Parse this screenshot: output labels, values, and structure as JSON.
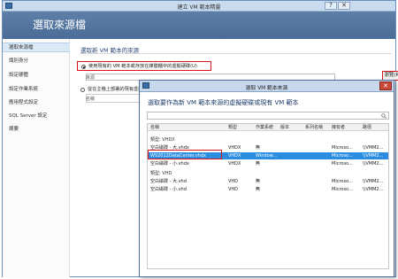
{
  "window": {
    "title": "建立 VM 範本精靈",
    "help_glyph": "?",
    "close_glyph": "✕",
    "page_title": "選取來源檔"
  },
  "sidebar": {
    "items": [
      {
        "label": "選取來源檔",
        "active": true
      },
      {
        "label": "識別身分"
      },
      {
        "label": "設定硬體"
      },
      {
        "label": "設定作業系統"
      },
      {
        "label": "應用程式設定"
      },
      {
        "label": "SQL Server 設定"
      },
      {
        "label": "摘要"
      }
    ]
  },
  "main": {
    "section_heading": "選取新 VM 範本的來源",
    "option_existing": "使用現有的 VM 範本或存放在媒體櫃中的虛擬硬碟(U)",
    "field_label_source": "來源",
    "browse_button": "瀏覽(R)...",
    "option_from_vm": "從在主機上部署的現有虛擬機器來",
    "field_label_name": "名稱"
  },
  "dialog": {
    "title": "選取 VM 範本來源",
    "close_glyph": "✕",
    "prompt": "選取要作為新 VM 範本來源的虛擬硬碟或現有 VM 範本",
    "search_icon": "magnifier",
    "columns": [
      "名稱",
      "類型",
      "作業系統",
      "版本",
      "系列名稱",
      "擁有者",
      "路徑"
    ],
    "groups": [
      {
        "label": "類型: VHDX",
        "rows": [
          [
            "空白磁碟 - 大.vhdx",
            "VHDX",
            "無",
            "",
            "",
            "Microso...",
            "\\\\VMM2..."
          ],
          [
            "WS2012DataCenter.vhdx",
            "VHDX",
            "Window...",
            "",
            "",
            "Microso...",
            "\\\\VMM2..."
          ],
          [
            "空白磁碟 - 小.vhdx",
            "VHDX",
            "無",
            "",
            "",
            "Microso...",
            "\\\\VMM2..."
          ]
        ]
      },
      {
        "label": "類型: VHD",
        "rows": [
          [
            "空白磁碟 - 大.vhd",
            "VHD",
            "無",
            "",
            "",
            "Microso...",
            "\\\\VMM2..."
          ],
          [
            "空白磁碟 - 小.vhd",
            "VHD",
            "無",
            "",
            "",
            "Microso...",
            "\\\\VMM2..."
          ]
        ]
      }
    ]
  }
}
